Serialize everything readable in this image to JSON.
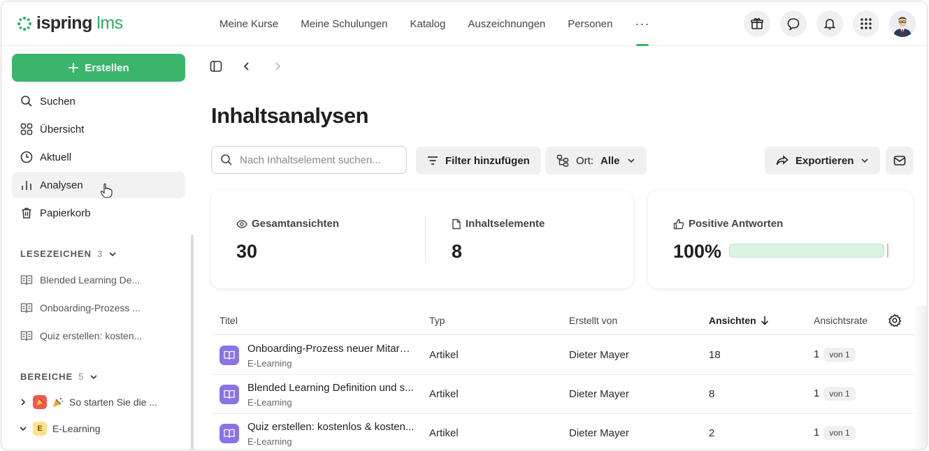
{
  "brand": {
    "name": "ispring",
    "suffix": "lms",
    "color": "#3bb56c"
  },
  "nav": {
    "items": [
      "Meine Kurse",
      "Meine Schulungen",
      "Katalog",
      "Auszeichnungen",
      "Personen"
    ],
    "more": "···"
  },
  "top_icons": [
    "gift-icon",
    "chat-icon",
    "bell-icon",
    "apps-grid-icon"
  ],
  "sidebar": {
    "create_label": "Erstellen",
    "items": [
      {
        "label": "Suchen",
        "icon": "search-icon"
      },
      {
        "label": "Übersicht",
        "icon": "grid-icon"
      },
      {
        "label": "Aktuell",
        "icon": "clock-icon"
      },
      {
        "label": "Analysen",
        "icon": "bar-chart-icon"
      },
      {
        "label": "Papierkorb",
        "icon": "trash-icon"
      }
    ],
    "bookmarks": {
      "title": "LESEZEICHEN",
      "count": "3",
      "items": [
        "Blended Learning De...",
        "Onboarding-Prozess ...",
        "Quiz erstellen: kosten..."
      ]
    },
    "areas": {
      "title": "BEREICHE",
      "count": "5",
      "items": [
        {
          "label": "So starten Sie die ...",
          "badge": ""
        },
        {
          "label": "E-Learning",
          "badge": "E"
        }
      ]
    }
  },
  "main": {
    "title": "Inhaltsanalysen",
    "search_placeholder": "Nach Inhaltselement suchen...",
    "filter_label": "Filter hinzufügen",
    "location_label": "Ort:",
    "location_value": "Alle",
    "export_label": "Exportieren",
    "stats": {
      "views_label": "Gesamtansichten",
      "views_value": "30",
      "items_label": "Inhaltselemente",
      "items_value": "8",
      "positive_label": "Positive Antworten",
      "positive_value": "100%",
      "positive_fraction": 1.0
    },
    "table": {
      "headers": {
        "title": "Titel",
        "type": "Typ",
        "author": "Erstellt von",
        "views": "Ansichten",
        "rate": "Ansichtsrate"
      },
      "rows": [
        {
          "title": "Onboarding-Prozess neuer Mitarbeiter",
          "area": "E-Learning",
          "type": "Artikel",
          "author": "Dieter Mayer",
          "views": "18",
          "rate": "1",
          "rate_of": "von 1"
        },
        {
          "title": "Blended Learning Definition und s...",
          "area": "E-Learning",
          "type": "Artikel",
          "author": "Dieter Mayer",
          "views": "8",
          "rate": "1",
          "rate_of": "von 1"
        },
        {
          "title": "Quiz erstellen: kostenlos & kosten...",
          "area": "E-Learning",
          "type": "Artikel",
          "author": "Dieter Mayer",
          "views": "2",
          "rate": "1",
          "rate_of": "von 1"
        }
      ]
    }
  }
}
